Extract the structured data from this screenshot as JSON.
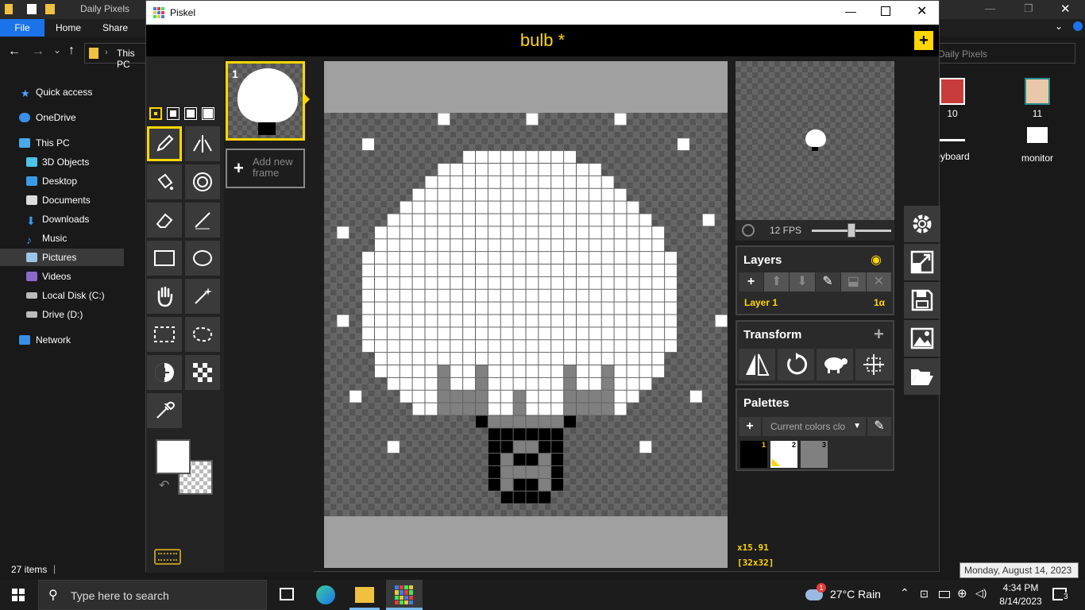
{
  "explorer": {
    "title": "Daily Pixels",
    "ribbon_tabs": [
      "File",
      "Home",
      "Share"
    ],
    "address": "This PC",
    "search_placeholder": "Daily Pixels",
    "nav": [
      {
        "label": "Quick access",
        "icon": "star-icon"
      },
      {
        "label": "OneDrive",
        "icon": "cloud-icon"
      },
      {
        "label": "This PC",
        "icon": "computer-icon"
      },
      {
        "label": "3D Objects",
        "icon": "cube-icon"
      },
      {
        "label": "Desktop",
        "icon": "desktop-icon"
      },
      {
        "label": "Documents",
        "icon": "document-icon"
      },
      {
        "label": "Downloads",
        "icon": "download-icon"
      },
      {
        "label": "Music",
        "icon": "music-icon"
      },
      {
        "label": "Pictures",
        "icon": "pictures-icon"
      },
      {
        "label": "Videos",
        "icon": "video-icon"
      },
      {
        "label": "Local Disk (C:)",
        "icon": "disk-icon"
      },
      {
        "label": "Drive (D:)",
        "icon": "drive-icon"
      },
      {
        "label": "Network",
        "icon": "network-icon"
      }
    ],
    "status": "27 items",
    "files": [
      {
        "label": "10"
      },
      {
        "label": "11"
      },
      {
        "label": "eyboard"
      },
      {
        "label": "monitor"
      }
    ]
  },
  "taskbar": {
    "search_placeholder": "Type here to search",
    "weather": "27°C  Rain",
    "weather_badge": "1",
    "time": "4:34 PM",
    "date": "8/14/2023",
    "notifications": "3",
    "tooltip": "Monday, August 14, 2023"
  },
  "piskel": {
    "window_title": "Piskel",
    "doc_title": "bulb *",
    "frame_number": "1",
    "add_frame_label": "Add new frame",
    "fps": "12 FPS",
    "fps_fraction": 0.5,
    "layers_title": "Layers",
    "layer_name": "Layer 1",
    "layer_alpha": "1α",
    "transform_title": "Transform",
    "palettes_title": "Palettes",
    "palette_select": "Current colors clo",
    "palette_colors": [
      {
        "index": "1",
        "color": "#000000"
      },
      {
        "index": "2",
        "color": "#ffffff"
      },
      {
        "index": "3",
        "color": "#808080"
      }
    ],
    "cursor_coords": "x15.91",
    "canvas_size": "[32x32]",
    "accent": "#ffd700"
  }
}
